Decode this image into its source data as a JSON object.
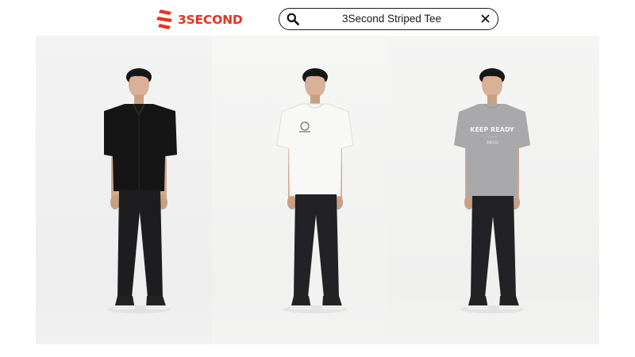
{
  "brand": {
    "name": "3SECOND",
    "accent_color": "#e63323"
  },
  "search": {
    "value": "3Second Striped Tee",
    "icon": "search-icon",
    "clear_icon": "close-icon"
  },
  "products": [
    {
      "top": "black-short-sleeve-shirt",
      "top_color": "#121212",
      "pants": "black-slim-jeans",
      "shoes": "black-white-sneakers",
      "background": "#f2f2f2"
    },
    {
      "top": "white-graphic-tee",
      "top_color": "#f7f7f5",
      "pants": "black-slim-jeans",
      "shoes": "black-white-sneakers",
      "background": "#f5f5f4"
    },
    {
      "top": "grey-graphic-tee",
      "top_color": "#a9a9ab",
      "pants": "black-slim-jeans",
      "shoes": "black-white-sneakers",
      "background": "#f4f4f3",
      "print_text": [
        "KEEP READY",
        "·········",
        "3SECD"
      ]
    }
  ]
}
